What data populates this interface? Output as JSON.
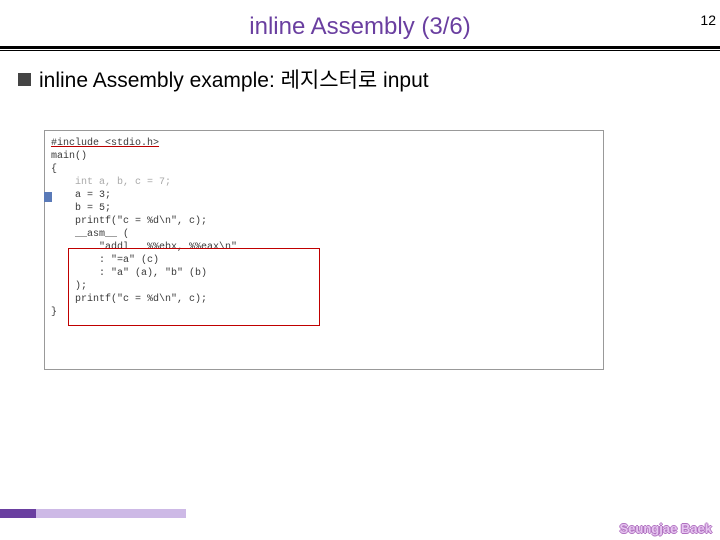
{
  "page_number": "12",
  "title": "inline Assembly (3/6)",
  "bullet": "inline Assembly example: 레지스터로 input",
  "code": {
    "l1": "#include <stdio.h>",
    "l2": "",
    "l3": "main()",
    "l4": "{",
    "l5": "    int a, b, c = 7;",
    "l6": "",
    "l7": "    a = 3;",
    "l8": "    b = 5;",
    "l9": "",
    "l10": "    printf(\"c = %d\\n\", c);",
    "l11": "",
    "l12": "    __asm__ (",
    "l13": "        \"addl   %%ebx, %%eax\\n\"",
    "l14": "        : \"=a\" (c)",
    "l15": "        : \"a\" (a), \"b\" (b)",
    "l16": "    );",
    "l17": "",
    "l18": "    printf(\"c = %d\\n\", c);",
    "l19": "}"
  },
  "author": "Seungjae Baek"
}
